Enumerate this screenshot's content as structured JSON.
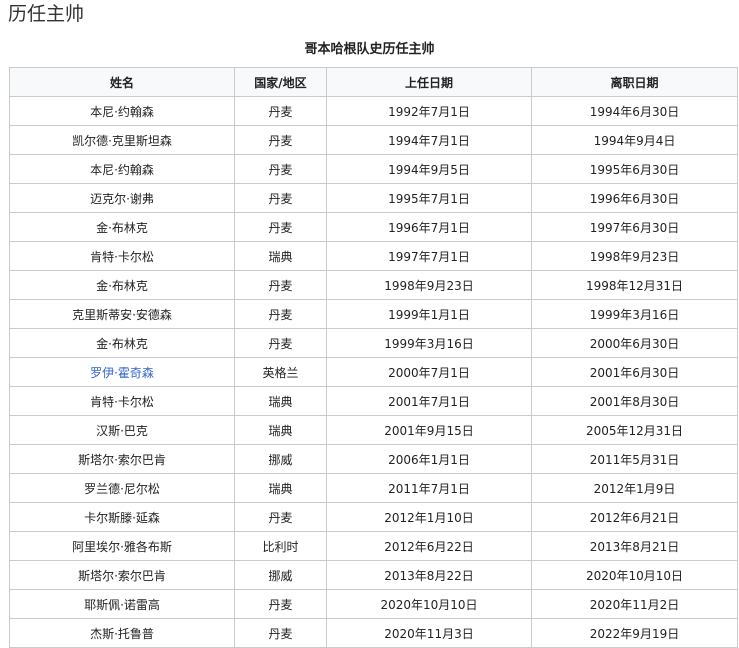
{
  "section": {
    "title": "历任主帅"
  },
  "table": {
    "caption": "哥本哈根队史历任主帅",
    "headers": [
      "姓名",
      "国家/地区",
      "上任日期",
      "离职日期"
    ],
    "rows": [
      {
        "name": "本尼·约翰森",
        "country": "丹麦",
        "start": "1992年7月1日",
        "end": "1994年6月30日"
      },
      {
        "name": "凯尔德·克里斯坦森",
        "country": "丹麦",
        "start": "1994年7月1日",
        "end": "1994年9月4日"
      },
      {
        "name": "本尼·约翰森",
        "country": "丹麦",
        "start": "1994年9月5日",
        "end": "1995年6月30日"
      },
      {
        "name": "迈克尔·谢弗",
        "country": "丹麦",
        "start": "1995年7月1日",
        "end": "1996年6月30日"
      },
      {
        "name": "金·布林克",
        "country": "丹麦",
        "start": "1996年7月1日",
        "end": "1997年6月30日"
      },
      {
        "name": "肯特·卡尔松",
        "country": "瑞典",
        "start": "1997年7月1日",
        "end": "1998年9月23日"
      },
      {
        "name": "金·布林克",
        "country": "丹麦",
        "start": "1998年9月23日",
        "end": "1998年12月31日"
      },
      {
        "name": "克里斯蒂安·安德森",
        "country": "丹麦",
        "start": "1999年1月1日",
        "end": "1999年3月16日"
      },
      {
        "name": "金·布林克",
        "country": "丹麦",
        "start": "1999年3月16日",
        "end": "2000年6月30日"
      },
      {
        "name": "罗伊·霍奇森",
        "country": "英格兰",
        "start": "2000年7月1日",
        "end": "2001年6月30日",
        "link": true
      },
      {
        "name": "肯特·卡尔松",
        "country": "瑞典",
        "start": "2001年7月1日",
        "end": "2001年8月30日"
      },
      {
        "name": "汉斯·巴克",
        "country": "瑞典",
        "start": "2001年9月15日",
        "end": "2005年12月31日"
      },
      {
        "name": "斯塔尔·索尔巴肯",
        "country": "挪威",
        "start": "2006年1月1日",
        "end": "2011年5月31日"
      },
      {
        "name": "罗兰德·尼尔松",
        "country": "瑞典",
        "start": "2011年7月1日",
        "end": "2012年1月9日"
      },
      {
        "name": "卡尔斯滕·延森",
        "country": "丹麦",
        "start": "2012年1月10日",
        "end": "2012年6月21日"
      },
      {
        "name": "阿里埃尔·雅各布斯",
        "country": "比利时",
        "start": "2012年6月22日",
        "end": "2013年8月21日"
      },
      {
        "name": "斯塔尔·索尔巴肯",
        "country": "挪威",
        "start": "2013年8月22日",
        "end": "2020年10月10日"
      },
      {
        "name": "耶斯佩·诺雷高",
        "country": "丹麦",
        "start": "2020年10月10日",
        "end": "2020年11月2日"
      },
      {
        "name": "杰斯·托鲁普",
        "country": "丹麦",
        "start": "2020年11月3日",
        "end": "2022年9月19日"
      }
    ]
  },
  "colors": {
    "link": "#3366cc",
    "border": "#c8ccd1",
    "header_bg": "#f8f9fa"
  }
}
